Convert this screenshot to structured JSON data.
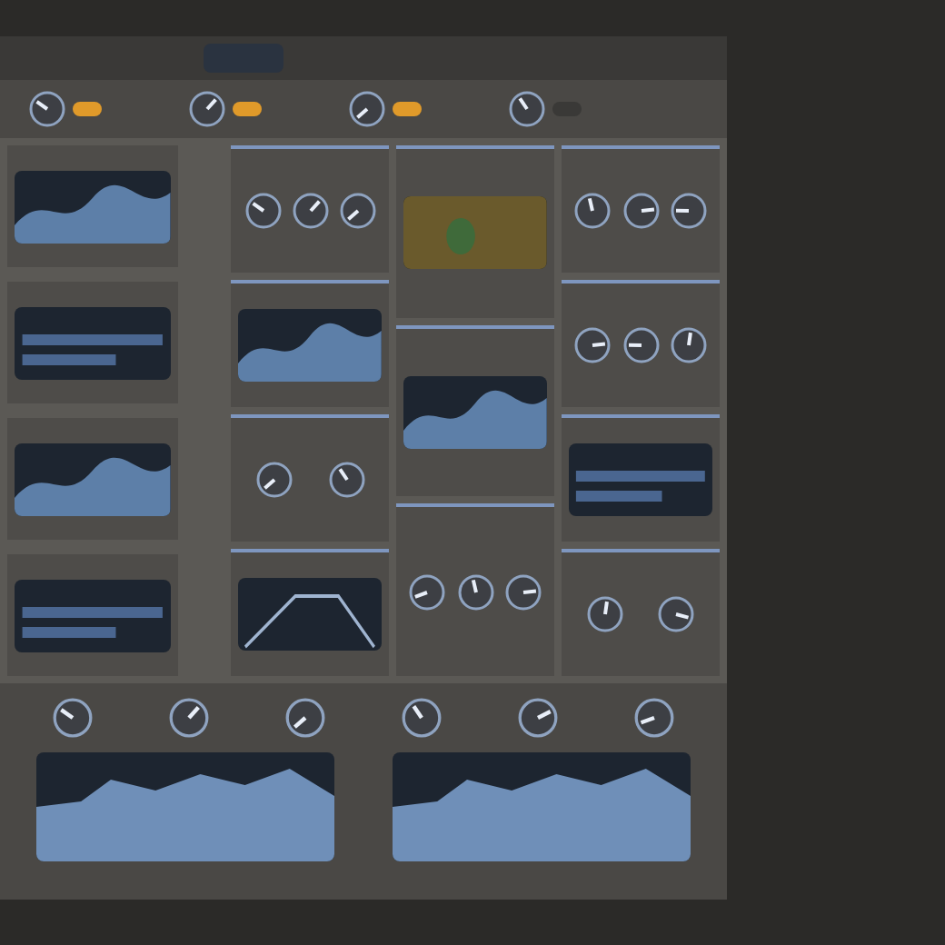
{
  "toolbar": {
    "knobs": [
      {
        "kind": "knob",
        "on": true
      },
      {
        "kind": "knob",
        "on": true
      },
      {
        "kind": "knob",
        "on": true
      },
      {
        "kind": "knob",
        "on": false
      }
    ]
  },
  "left_column": [
    {
      "kind": "wave"
    },
    {
      "kind": "meter"
    },
    {
      "kind": "wave"
    },
    {
      "kind": "meter"
    }
  ],
  "modules": [
    [
      {
        "kind": "knobs",
        "knobs": [
          {
            "kind": "knob"
          },
          {
            "kind": "knob"
          },
          {
            "kind": "knob"
          }
        ]
      },
      {
        "kind": "wave"
      },
      {
        "kind": "knobs",
        "knobs": [
          {
            "kind": "knob"
          },
          {
            "kind": "knob"
          }
        ]
      },
      {
        "kind": "envelope"
      }
    ],
    [
      {
        "kind": "scope"
      },
      {
        "kind": "wave"
      },
      {
        "kind": "knobs",
        "knobs": [
          {
            "kind": "knob"
          },
          {
            "kind": "knob"
          },
          {
            "kind": "knob"
          }
        ]
      }
    ],
    [
      {
        "kind": "knobs",
        "knobs": [
          {
            "kind": "knob"
          },
          {
            "kind": "knob"
          },
          {
            "kind": "knob"
          }
        ]
      },
      {
        "kind": "knobs",
        "knobs": [
          {
            "kind": "knob"
          },
          {
            "kind": "knob"
          },
          {
            "kind": "knob"
          }
        ]
      },
      {
        "kind": "meter"
      },
      {
        "kind": "knobs",
        "knobs": [
          {
            "kind": "knob"
          },
          {
            "kind": "knob"
          }
        ]
      }
    ]
  ],
  "bottom": {
    "knobs": [
      {
        "kind": "knob"
      },
      {
        "kind": "knob"
      },
      {
        "kind": "knob"
      },
      {
        "kind": "knob"
      },
      {
        "kind": "knob"
      },
      {
        "kind": "knob"
      }
    ],
    "displays": [
      {
        "kind": "spectrum"
      },
      {
        "kind": "spectrum"
      }
    ]
  }
}
